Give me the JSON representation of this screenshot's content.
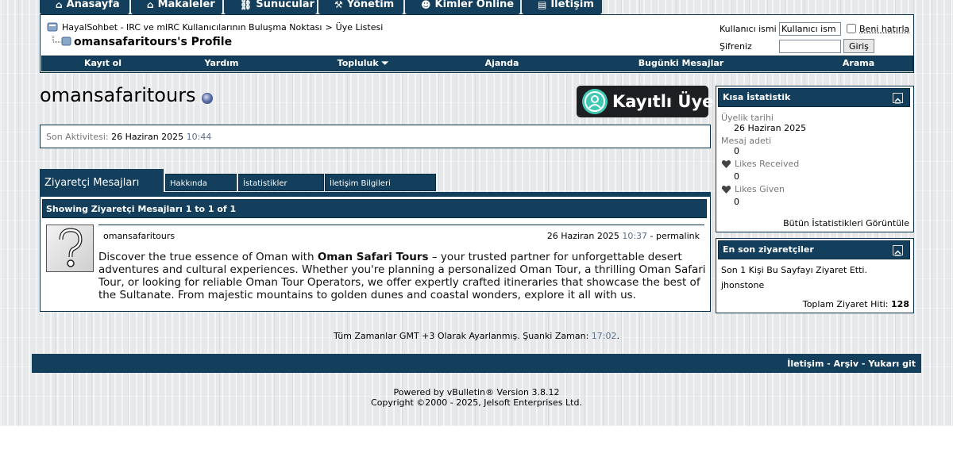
{
  "topnav": [
    {
      "label": "Anasayfa",
      "icon": "home-icon"
    },
    {
      "label": "Makaleler",
      "icon": "home-icon"
    },
    {
      "label": "Sunucular",
      "icon": "link-icon"
    },
    {
      "label": "Yönetim",
      "icon": "gavel-icon"
    },
    {
      "label": "Kimler Online",
      "icon": "users-icon"
    },
    {
      "label": "İletişim",
      "icon": "document-icon"
    }
  ],
  "breadcrumb": {
    "site": "HayalSohbet - IRC ve mIRC Kullanıcılarının Buluşma Noktası",
    "separator": ">",
    "section": "Üye Listesi",
    "current": "omansafaritours's Profile"
  },
  "login": {
    "username_label": "Kullanıcı ismi",
    "username_value": "Kullanıcı ism",
    "password_label": "Şifreniz",
    "remember_label": "Beni hatırla",
    "submit_label": "Giriş"
  },
  "menubar": [
    "Kayıt ol",
    "Yardım",
    "Topluluk",
    "Ajanda",
    "Bugünki Mesajlar",
    "Arama"
  ],
  "profile": {
    "username": "omansafaritours",
    "rank": "Kayıtlı Üye",
    "last_activity_label": "Son Aktivitesi:",
    "last_activity_date": "26 Haziran 2025",
    "last_activity_time": "10:44"
  },
  "tabs": [
    "Ziyaretçi Mesajları",
    "Hakkında",
    "İstatistikler",
    "İletişim Bilgileri"
  ],
  "visitor_messages": {
    "header": "Showing Ziyaretçi Mesajları 1 to 1 of 1",
    "message": {
      "author": "omansafaritours",
      "date": "26 Haziran 2025",
      "time": "10:37",
      "permalink": "- permalink",
      "text_before": "Discover the true essence of Oman with ",
      "text_bold": "Oman Safari Tours",
      "text_after": " – your trusted partner for unforgettable desert adventures and cultural experiences. Whether you're planning a personalized Oman Tour, a thrilling Oman Safari Tour, or looking for reliable Oman Tour Operators, we offer expertly crafted itineraries that showcase the best of the Sultanate. From majestic mountains to golden dunes and coastal wonders, explore it all with us."
    }
  },
  "stats": {
    "title": "Kısa İstatistik",
    "join_label": "Üyelik tarihi",
    "join_value": "26 Haziran 2025",
    "posts_label": "Mesaj adeti",
    "posts_value": "0",
    "likes_received_label": "Likes Received",
    "likes_received_value": "0",
    "likes_given_label": "Likes Given",
    "likes_given_value": "0",
    "all_stats_link": "Bütün İstatistikleri Görüntüle"
  },
  "visitors": {
    "title": "En son ziyaretçiler",
    "summary": "Son 1 Kişi Bu Sayfayı Ziyaret Etti.",
    "visitor": "jhonstone",
    "total_label": "Toplam Ziyaret Hiti:",
    "total_value": "128"
  },
  "footer": {
    "timezone_text": "Tüm Zamanlar GMT +3 Olarak Ayarlanmış. Şuanki Zaman:",
    "current_time": "17:02",
    "links": [
      "İletişim",
      "Arşiv",
      "Yukarı git"
    ],
    "powered": "Powered by vBulletin® Version 3.8.12",
    "copyright": "Copyright ©2000 - 2025, Jelsoft Enterprises Ltd."
  },
  "colors": {
    "navy": "#133e5c",
    "border": "#0b3148",
    "time": "#5b6e8c",
    "rank_bg": "#1e1f22",
    "rank_icon": "#3fc9b5"
  }
}
